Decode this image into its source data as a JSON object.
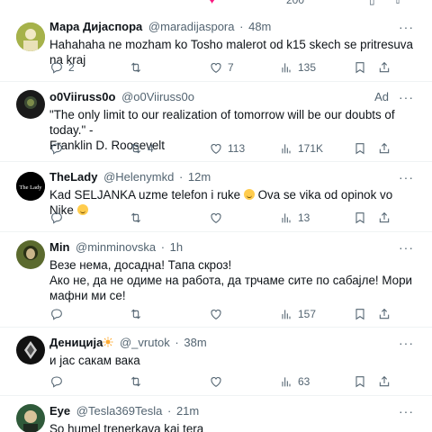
{
  "top_strip": {
    "like_count": "",
    "view_count": "200"
  },
  "tweets": [
    {
      "name": "Мара Дијаспора",
      "handle": "@maradijaspora",
      "time": "48m",
      "text": "Hahahaha ne mozham ko Tosho malerot od k15 skech se pritresuva na kraj",
      "replies": "2",
      "retweets": "",
      "likes": "7",
      "views": "135"
    },
    {
      "name": "o0Viiruss0o",
      "handle": "@o0Viiruss0o",
      "badge": "Ad",
      "text": "\"The only limit to our realization of tomorrow will be our doubts of today.\" -\nFranklin D. Roosevelt",
      "replies": "",
      "retweets": "4",
      "likes": "113",
      "views": "171K"
    },
    {
      "name": "TheLady",
      "handle": "@Helenymkd",
      "time": "12m",
      "avatar_text": "The Lady",
      "text_a": "Kad SELJANKA uzme telefon i ruke ",
      "text_b": " Ova se vika od opinok vo Nike",
      "replies": "",
      "retweets": "",
      "likes": "",
      "views": "13"
    },
    {
      "name": "Min",
      "handle": "@minminovska",
      "time": "1h",
      "text": "Везе нема, досадна! Тапа скроз!\nАко не, да не одиме на работа, да трчаме сите по сабајле! Мори мафни ми се!",
      "replies": "",
      "retweets": "",
      "likes": "",
      "views": "157"
    },
    {
      "name": "Дениција",
      "handle": "@_vrutok",
      "time": "38m",
      "text": "и јас сакам вака",
      "replies": "",
      "retweets": "",
      "likes": "",
      "views": "63"
    },
    {
      "name": "Eye",
      "handle": "@Tesla369Tesla",
      "time": "21m",
      "text": "So humel trenerkava kaj tera"
    }
  ],
  "separator": "·",
  "more_glyph": "···",
  "colors": {
    "text": "#0f1419",
    "muted": "#536471",
    "border": "#eff3f4",
    "like_pink": "#f91880"
  }
}
